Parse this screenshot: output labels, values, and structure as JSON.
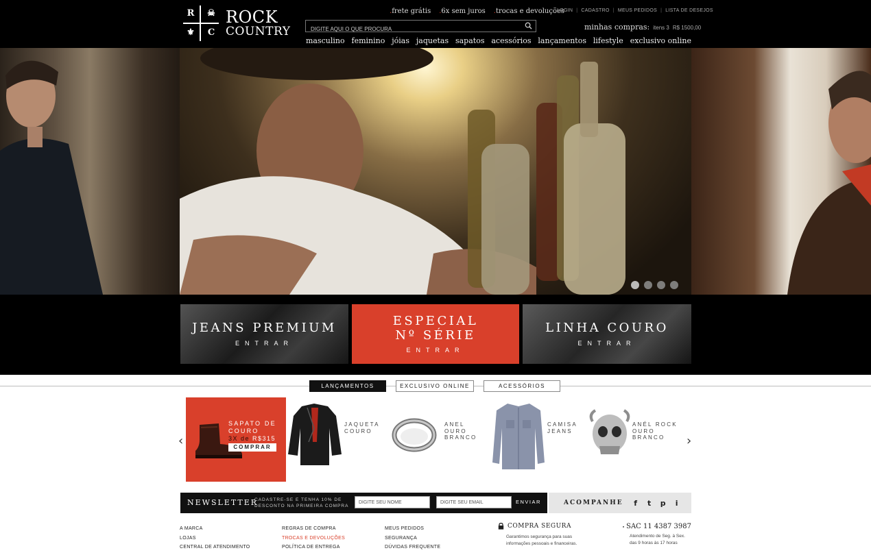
{
  "logo": {
    "quad": [
      "R",
      "",
      "",
      "C"
    ],
    "line1": "ROCK",
    "line2": "COUNTRY"
  },
  "promo": {
    "items": [
      {
        "dot": ".",
        "label": "frete grátis"
      },
      {
        "dot": ".",
        "label": "6x sem juros"
      },
      {
        "dot": ".",
        "label": "trocas e devoluções"
      }
    ]
  },
  "search": {
    "placeholder": "DIGITE AQUI O QUE PROCURA"
  },
  "account": {
    "links": [
      "LOGIN",
      "CADASTRO",
      "MEUS PEDIDOS",
      "LISTA DE DESEJOS"
    ],
    "sep": "|"
  },
  "cart": {
    "label": "minhas compras:",
    "items": "itens 3",
    "total": "R$ 1500,00"
  },
  "nav": [
    "masculino",
    "feminino",
    "jóias",
    "jaquetas",
    "sapatos",
    "acessórios",
    "lançamentos",
    "lifestyle",
    "exclusivo online"
  ],
  "carousel": {
    "slides": 4,
    "active": 0
  },
  "banners": [
    {
      "title": "JEANS PREMIUM",
      "cta": "ENTRAR"
    },
    {
      "title": "ESPECIAL\nNº SÉRIE",
      "cta": "ENTRAR"
    },
    {
      "title": "LINHA COURO",
      "cta": "ENTRAR"
    }
  ],
  "tabs": [
    {
      "label": "LANÇAMENTOS",
      "active": true
    },
    {
      "label": "EXCLUSIVO ONLINE",
      "active": false
    },
    {
      "label": "ACESSÓRIOS",
      "active": false
    }
  ],
  "arrows": {
    "prev": "‹",
    "next": "›"
  },
  "featured": {
    "title": "SAPATO DE\nCOURO",
    "price_prefix": "3X de ",
    "price": "R$315",
    "button": "COMPRAR"
  },
  "products": [
    {
      "name": "JAQUETA\nCOURO"
    },
    {
      "name": "ANEL\nOURO\nBRANCO"
    },
    {
      "name": "CAMISA\nJEANS"
    },
    {
      "name": "ANÉL ROCK\nOURO\nBRANCO"
    }
  ],
  "newsletter": {
    "title": "NEWSLETTER",
    "subtitle": "CADASTRE-SE E TENHA 10% DE DESCONTO NA PRIMEIRA COMPRA",
    "name_placeholder": "DIGITE SEU NOME",
    "email_placeholder": "DIGITE SEU EMAIL",
    "send": "ENVIAR"
  },
  "follow": {
    "label": "ACOMPANHE",
    "icons": [
      "f",
      "t",
      "p",
      "i"
    ]
  },
  "footer": {
    "col1": [
      "A MARCA",
      "LOJAS",
      "CENTRAL DE ATENDIMENTO"
    ],
    "col2": [
      "REGRAS DE COMPRA",
      "TROCAS E DEVOLUÇÕES",
      "POLÍTICA DE ENTREGA"
    ],
    "col3": [
      "MEUS PEDIDOS",
      "SEGURANÇA",
      "DÚVIDAS FREQUENTE"
    ],
    "secure": {
      "title": "COMPRA SEGURA",
      "text": "Garantimos segurança para suas informações pessoais e financeiras."
    },
    "sac": {
      "title": "SAC  11 4387 3987",
      "text": "Atendimento de Seg. à Sex. das 9 horas às 17 horas"
    }
  },
  "colors": {
    "accent": "#d9402b",
    "header_bg": "#000000"
  }
}
